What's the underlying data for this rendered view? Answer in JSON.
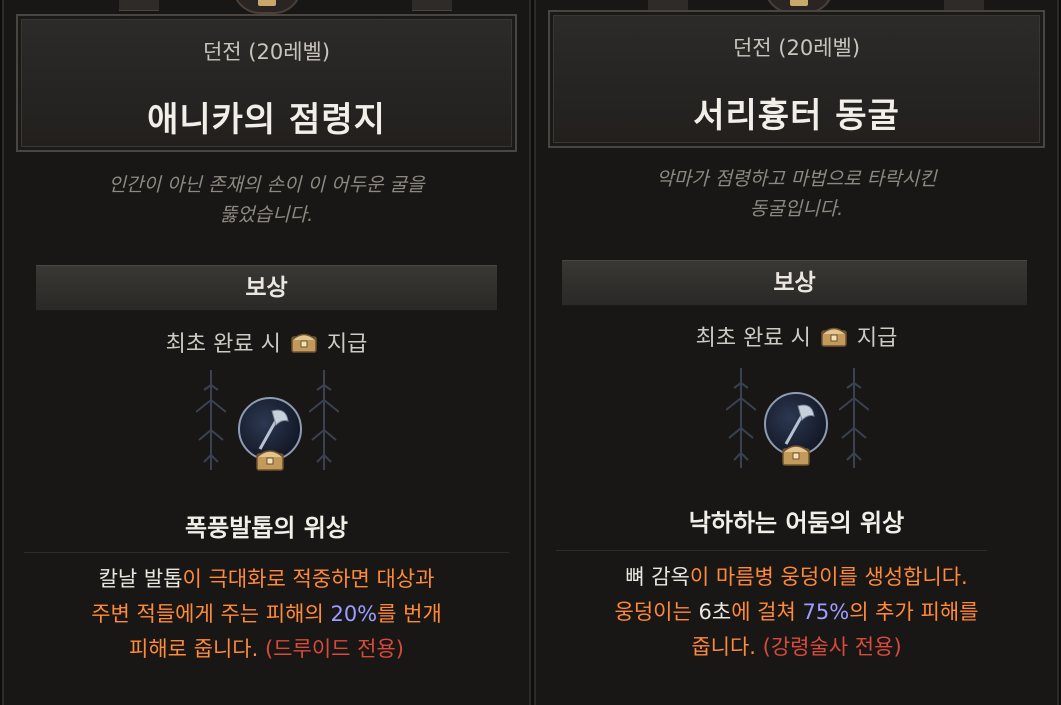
{
  "dungeons": [
    {
      "subtitle": "던전 (20레벨)",
      "title": "애니카의 점령지",
      "flavor_line1": "인간이 아닌 존재의 손이 이 어두운 굴을",
      "flavor_line2": "뚫었습니다.",
      "reward_label": "보상",
      "first_clear_prefix": "최초 완료 시",
      "first_clear_suffix": "지급",
      "aspect_name": "폭풍발톱의 위상",
      "desc": {
        "l1a": "칼날 발톱",
        "l1b": "이 극대화로 적중하면 대상과",
        "l2a": "주변 적들에게 주는 피해의 ",
        "l2b": "20%",
        "l2c": "를 번개",
        "l3a": "피해로 줍니다. ",
        "l3b": "(드루이드 전용)"
      }
    },
    {
      "subtitle": "던전 (20레벨)",
      "title": "서리흉터 동굴",
      "flavor_line1": "악마가 점령하고 마법으로 타락시킨",
      "flavor_line2": "동굴입니다.",
      "reward_label": "보상",
      "first_clear_prefix": "최초 완료 시",
      "first_clear_suffix": "지급",
      "aspect_name": "낙하하는 어둠의 위상",
      "desc": {
        "l1a": "뼈 감옥",
        "l1b": "이 마름병 웅덩이를 생성합니다.",
        "l2a": "웅덩이는 ",
        "l2w": "6초",
        "l2b": "에 걸쳐 ",
        "l2c": "75%",
        "l2d": "의 추가 피해를",
        "l3a": "줍니다. ",
        "l3b": "(강령술사 전용)"
      }
    }
  ],
  "icons": {
    "chest": "chest-icon",
    "aspect": "axe-aspect-icon",
    "ornament": "thorn-ornament"
  },
  "colors": {
    "highlight_orange": "#ff8a3a",
    "value_blue": "#9e9cff",
    "class_red": "#d84a3a",
    "chest_gold": "#d8b374"
  }
}
